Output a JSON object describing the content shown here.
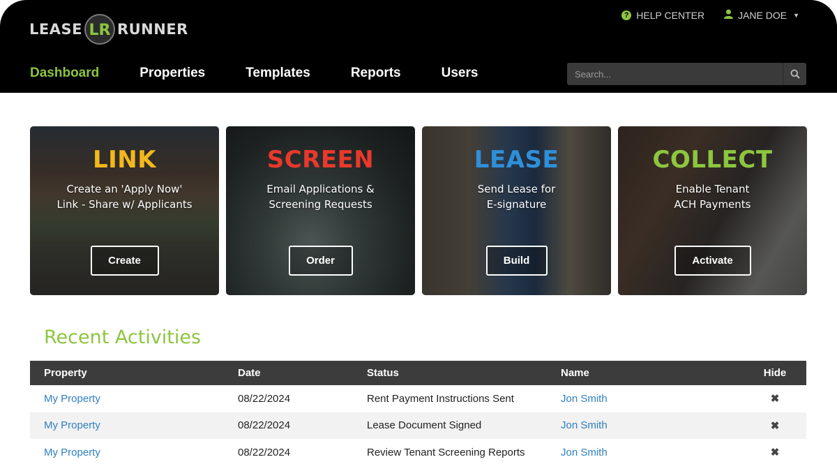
{
  "brand": {
    "left": "LEASE",
    "right": "RUNNER",
    "mark": "LR"
  },
  "top_links": {
    "help": "HELP CENTER",
    "user": "JANE DOE"
  },
  "nav": [
    "Dashboard",
    "Properties",
    "Templates",
    "Reports",
    "Users"
  ],
  "search": {
    "placeholder": "Search..."
  },
  "cards": [
    {
      "title": "LINK",
      "desc1": "Create an 'Apply Now'",
      "desc2": "Link - Share w/ Applicants",
      "button": "Create",
      "color": "#f2b81c"
    },
    {
      "title": "SCREEN",
      "desc1": "Email Applications &",
      "desc2": "Screening Requests",
      "button": "Order",
      "color": "#e8392b"
    },
    {
      "title": "LEASE",
      "desc1": "Send Lease for",
      "desc2": "E-signature",
      "button": "Build",
      "color": "#2f8fd8"
    },
    {
      "title": "COLLECT",
      "desc1": "Enable Tenant",
      "desc2": "ACH Payments",
      "button": "Activate",
      "color": "#8cc63f"
    }
  ],
  "activities": {
    "title": "Recent Activities",
    "columns": [
      "Property",
      "Date",
      "Status",
      "Name",
      "Hide"
    ],
    "rows": [
      {
        "property": "My Property",
        "date": "08/22/2024",
        "status": "Rent Payment Instructions Sent",
        "name": "Jon Smith"
      },
      {
        "property": "My Property",
        "date": "08/22/2024",
        "status": "Lease Document Signed",
        "name": "Jon Smith"
      },
      {
        "property": "My Property",
        "date": "08/22/2024",
        "status": "Review Tenant Screening Reports",
        "name": "Jon Smith"
      }
    ]
  },
  "colors": {
    "accent": "#8cc63f",
    "header_bg": "#000000",
    "link": "#2e7fbf",
    "table_header": "#3c3c3c"
  }
}
